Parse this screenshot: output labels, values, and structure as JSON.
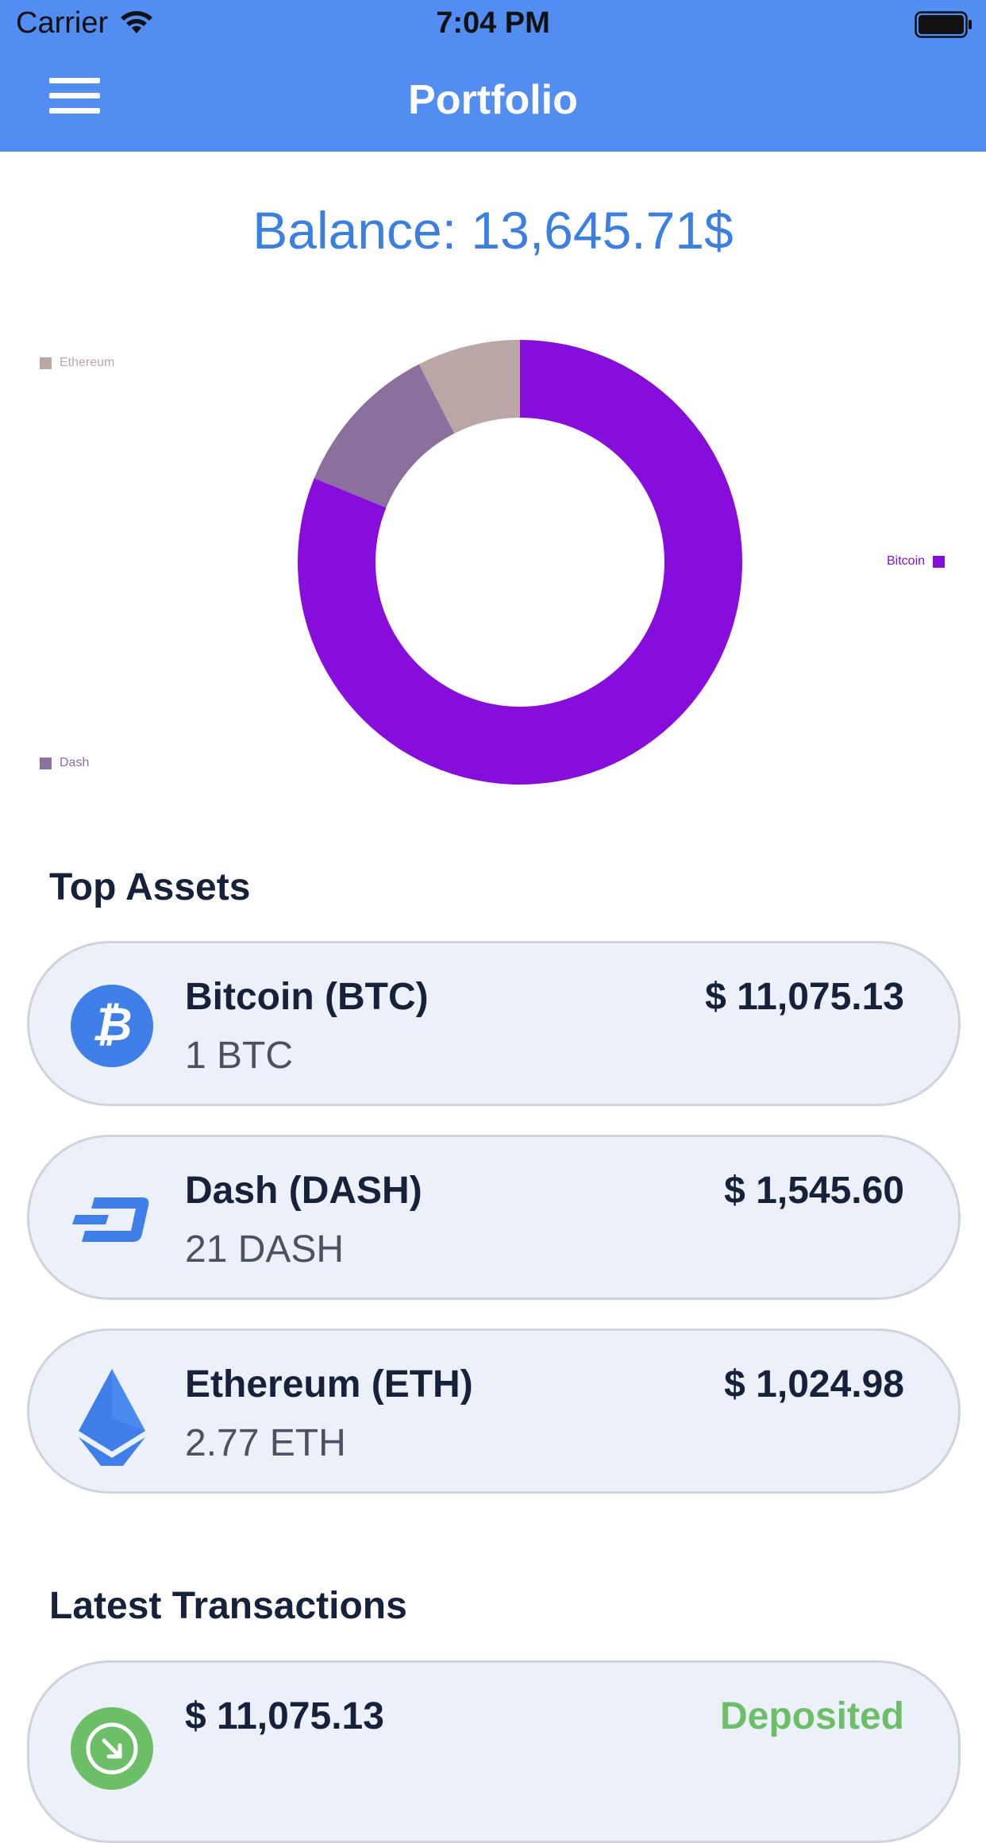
{
  "status_bar": {
    "carrier": "Carrier",
    "time": "7:04 PM"
  },
  "header": {
    "title": "Portfolio",
    "menu_icon": "hamburger-menu-icon"
  },
  "balance": {
    "text": "Balance: 13,645.71$"
  },
  "chart_data": {
    "type": "pie",
    "donut": true,
    "categories": [
      "Bitcoin",
      "Dash",
      "Ethereum"
    ],
    "values": [
      11075.13,
      1545.6,
      1024.98
    ],
    "colors": [
      "#870ddd",
      "#8b6f9c",
      "#b9a6a5"
    ],
    "legend": [
      "Bitcoin",
      "Dash",
      "Ethereum"
    ]
  },
  "top_assets": {
    "title": "Top Assets",
    "items": [
      {
        "name": "Bitcoin (BTC)",
        "amount": "1 BTC",
        "value": "$ 11,075.13",
        "icon": "bitcoin-icon"
      },
      {
        "name": "Dash (DASH)",
        "amount": "21 DASH",
        "value": "$ 1,545.60",
        "icon": "dash-icon"
      },
      {
        "name": "Ethereum (ETH)",
        "amount": "2.77 ETH",
        "value": "$ 1,024.98",
        "icon": "ethereum-icon"
      }
    ]
  },
  "latest_transactions": {
    "title": "Latest Transactions",
    "items": [
      {
        "amount": "$ 11,075.13",
        "status": "Deposited",
        "status_color": "#6cbf67",
        "icon": "deposit-icon"
      }
    ]
  }
}
